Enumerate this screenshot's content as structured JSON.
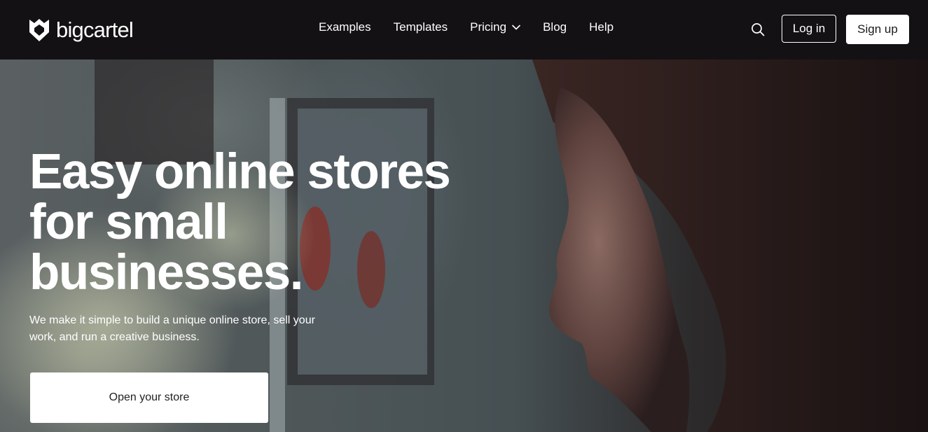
{
  "header": {
    "logo_text": "bigcartel",
    "nav": [
      {
        "label": "Examples"
      },
      {
        "label": "Templates"
      },
      {
        "label": "Pricing",
        "has_dropdown": true
      },
      {
        "label": "Blog"
      },
      {
        "label": "Help"
      }
    ],
    "search_icon": "search-icon",
    "login_label": "Log in",
    "signup_label": "Sign up"
  },
  "hero": {
    "headline_lines": [
      "Easy online stores",
      "for small",
      "businesses."
    ],
    "subhead": "We make it simple to build a unique online store, sell your work, and run a creative business.",
    "cta_label": "Open your store"
  },
  "colors": {
    "header_bg": "#141114",
    "text": "#ffffff",
    "button_bg": "#ffffff"
  }
}
